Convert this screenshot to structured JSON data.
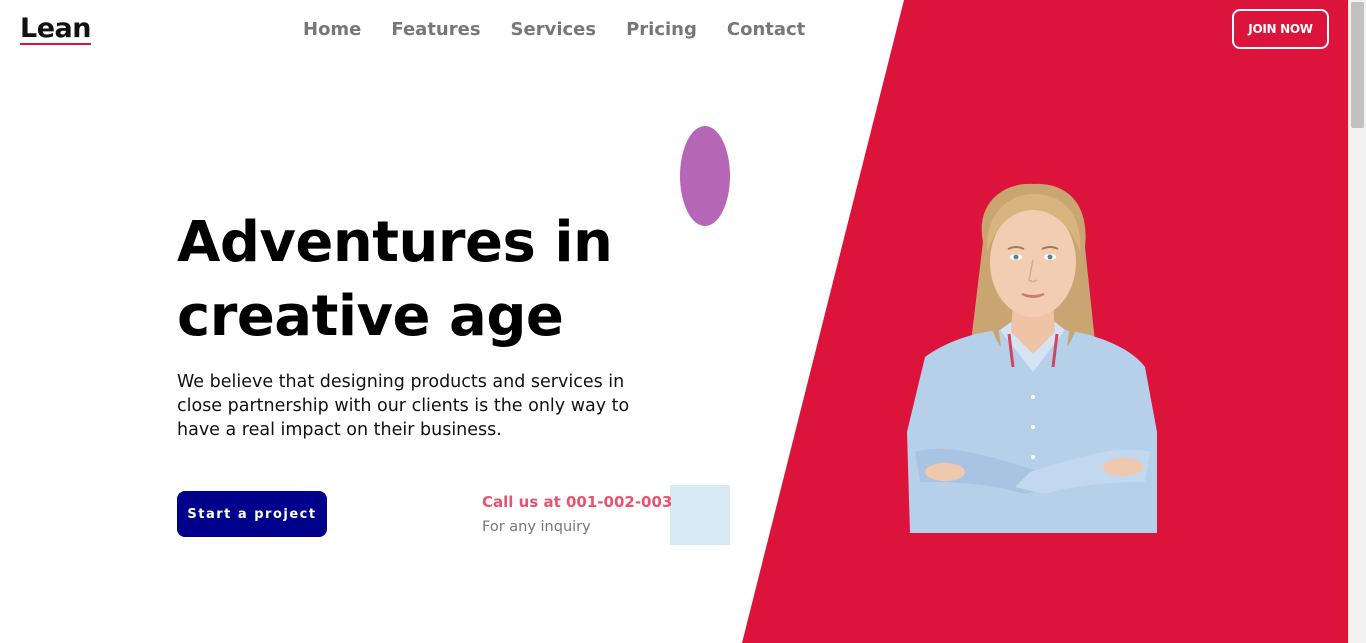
{
  "brand": {
    "logo": "Lean"
  },
  "nav": {
    "items": [
      "Home",
      "Features",
      "Services",
      "Pricing",
      "Contact"
    ]
  },
  "header": {
    "join_label": "JOIN NOW"
  },
  "hero": {
    "title_line1": "Adventures in",
    "title_line2": "creative age",
    "description": "We believe that designing products and services in close partnership with our clients is the only way to have a real impact on their business.",
    "cta_label": "Start a project",
    "call_text": "Call us at 001-002-003",
    "inquiry_text": "For any inquiry"
  },
  "colors": {
    "accent": "#dc143c",
    "button": "#00008b",
    "call_text": "#e8536f",
    "oval": "#b666b6",
    "square": "#d8eaf3"
  }
}
